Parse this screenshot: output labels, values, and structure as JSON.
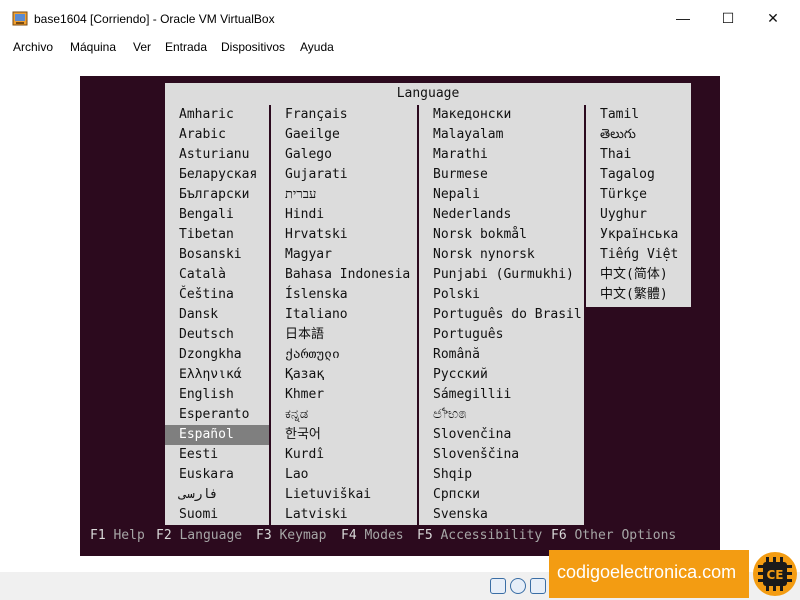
{
  "window": {
    "title": "base1604 [Corriendo] - Oracle VM VirtualBox",
    "minimize_glyph": "—",
    "maximize_glyph": "☐",
    "close_glyph": "✕"
  },
  "menu": {
    "items": [
      "Archivo",
      "Máquina",
      "Ver",
      "Entrada",
      "Dispositivos",
      "Ayuda"
    ]
  },
  "installer": {
    "dialog_title": "Language",
    "columns": [
      [
        "Amharic",
        "Arabic",
        "Asturianu",
        "Беларуская",
        "Български",
        "Bengali",
        "Tibetan",
        "Bosanski",
        "Català",
        "Čeština",
        "Dansk",
        "Deutsch",
        "Dzongkha",
        "Ελληνικά",
        "English",
        "Esperanto",
        "Español",
        "Eesti",
        "Euskara",
        "فارسی",
        "Suomi"
      ],
      [
        "Français",
        "Gaeilge",
        "Galego",
        "Gujarati",
        "עברית",
        "Hindi",
        "Hrvatski",
        "Magyar",
        "Bahasa Indonesia",
        "Íslenska",
        "Italiano",
        "日本語",
        "ქართული",
        "Қазақ",
        "Khmer",
        "ಕನ್ನಡ",
        "한국어",
        "Kurdî",
        "Lao",
        "Lietuviškai",
        "Latviski"
      ],
      [
        "Македонски",
        "Malayalam",
        "Marathi",
        "Burmese",
        "Nepali",
        "Nederlands",
        "Norsk bokmål",
        "Norsk nynorsk",
        "Punjabi (Gurmukhi)",
        "Polski",
        "Português do Brasil",
        "Português",
        "Română",
        "Русский",
        "Sámegillii",
        "ජ෦භ෧",
        "Slovenčina",
        "Slovenščina",
        "Shqip",
        "Српски",
        "Svenska"
      ],
      [
        "Tamil",
        "తెలుగు",
        "Thai",
        "Tagalog",
        "Türkçe",
        "Uyghur",
        "Українська",
        "Tiếng Việt",
        "中文(简体)",
        "中文(繁體)"
      ]
    ],
    "selected": "Español",
    "fkeys": [
      {
        "key": "F1",
        "label": "Help"
      },
      {
        "key": "F2",
        "label": "Language"
      },
      {
        "key": "F3",
        "label": "Keymap"
      },
      {
        "key": "F4",
        "label": "Modes"
      },
      {
        "key": "F5",
        "label": "Accessibility"
      },
      {
        "key": "F6",
        "label": "Other Options"
      }
    ]
  },
  "statusbar": {
    "icons": [
      "hard-disk-icon",
      "optical-drive-icon",
      "network-icon",
      "usb-icon"
    ]
  },
  "watermark": {
    "text": "codigoelectronica.com",
    "logo_text": "CE",
    "color": "#f39c12"
  },
  "colors": {
    "vm_background": "#2c0a1e",
    "dialog_background": "#dcdcdc",
    "selected_background": "#7f7f7f"
  }
}
